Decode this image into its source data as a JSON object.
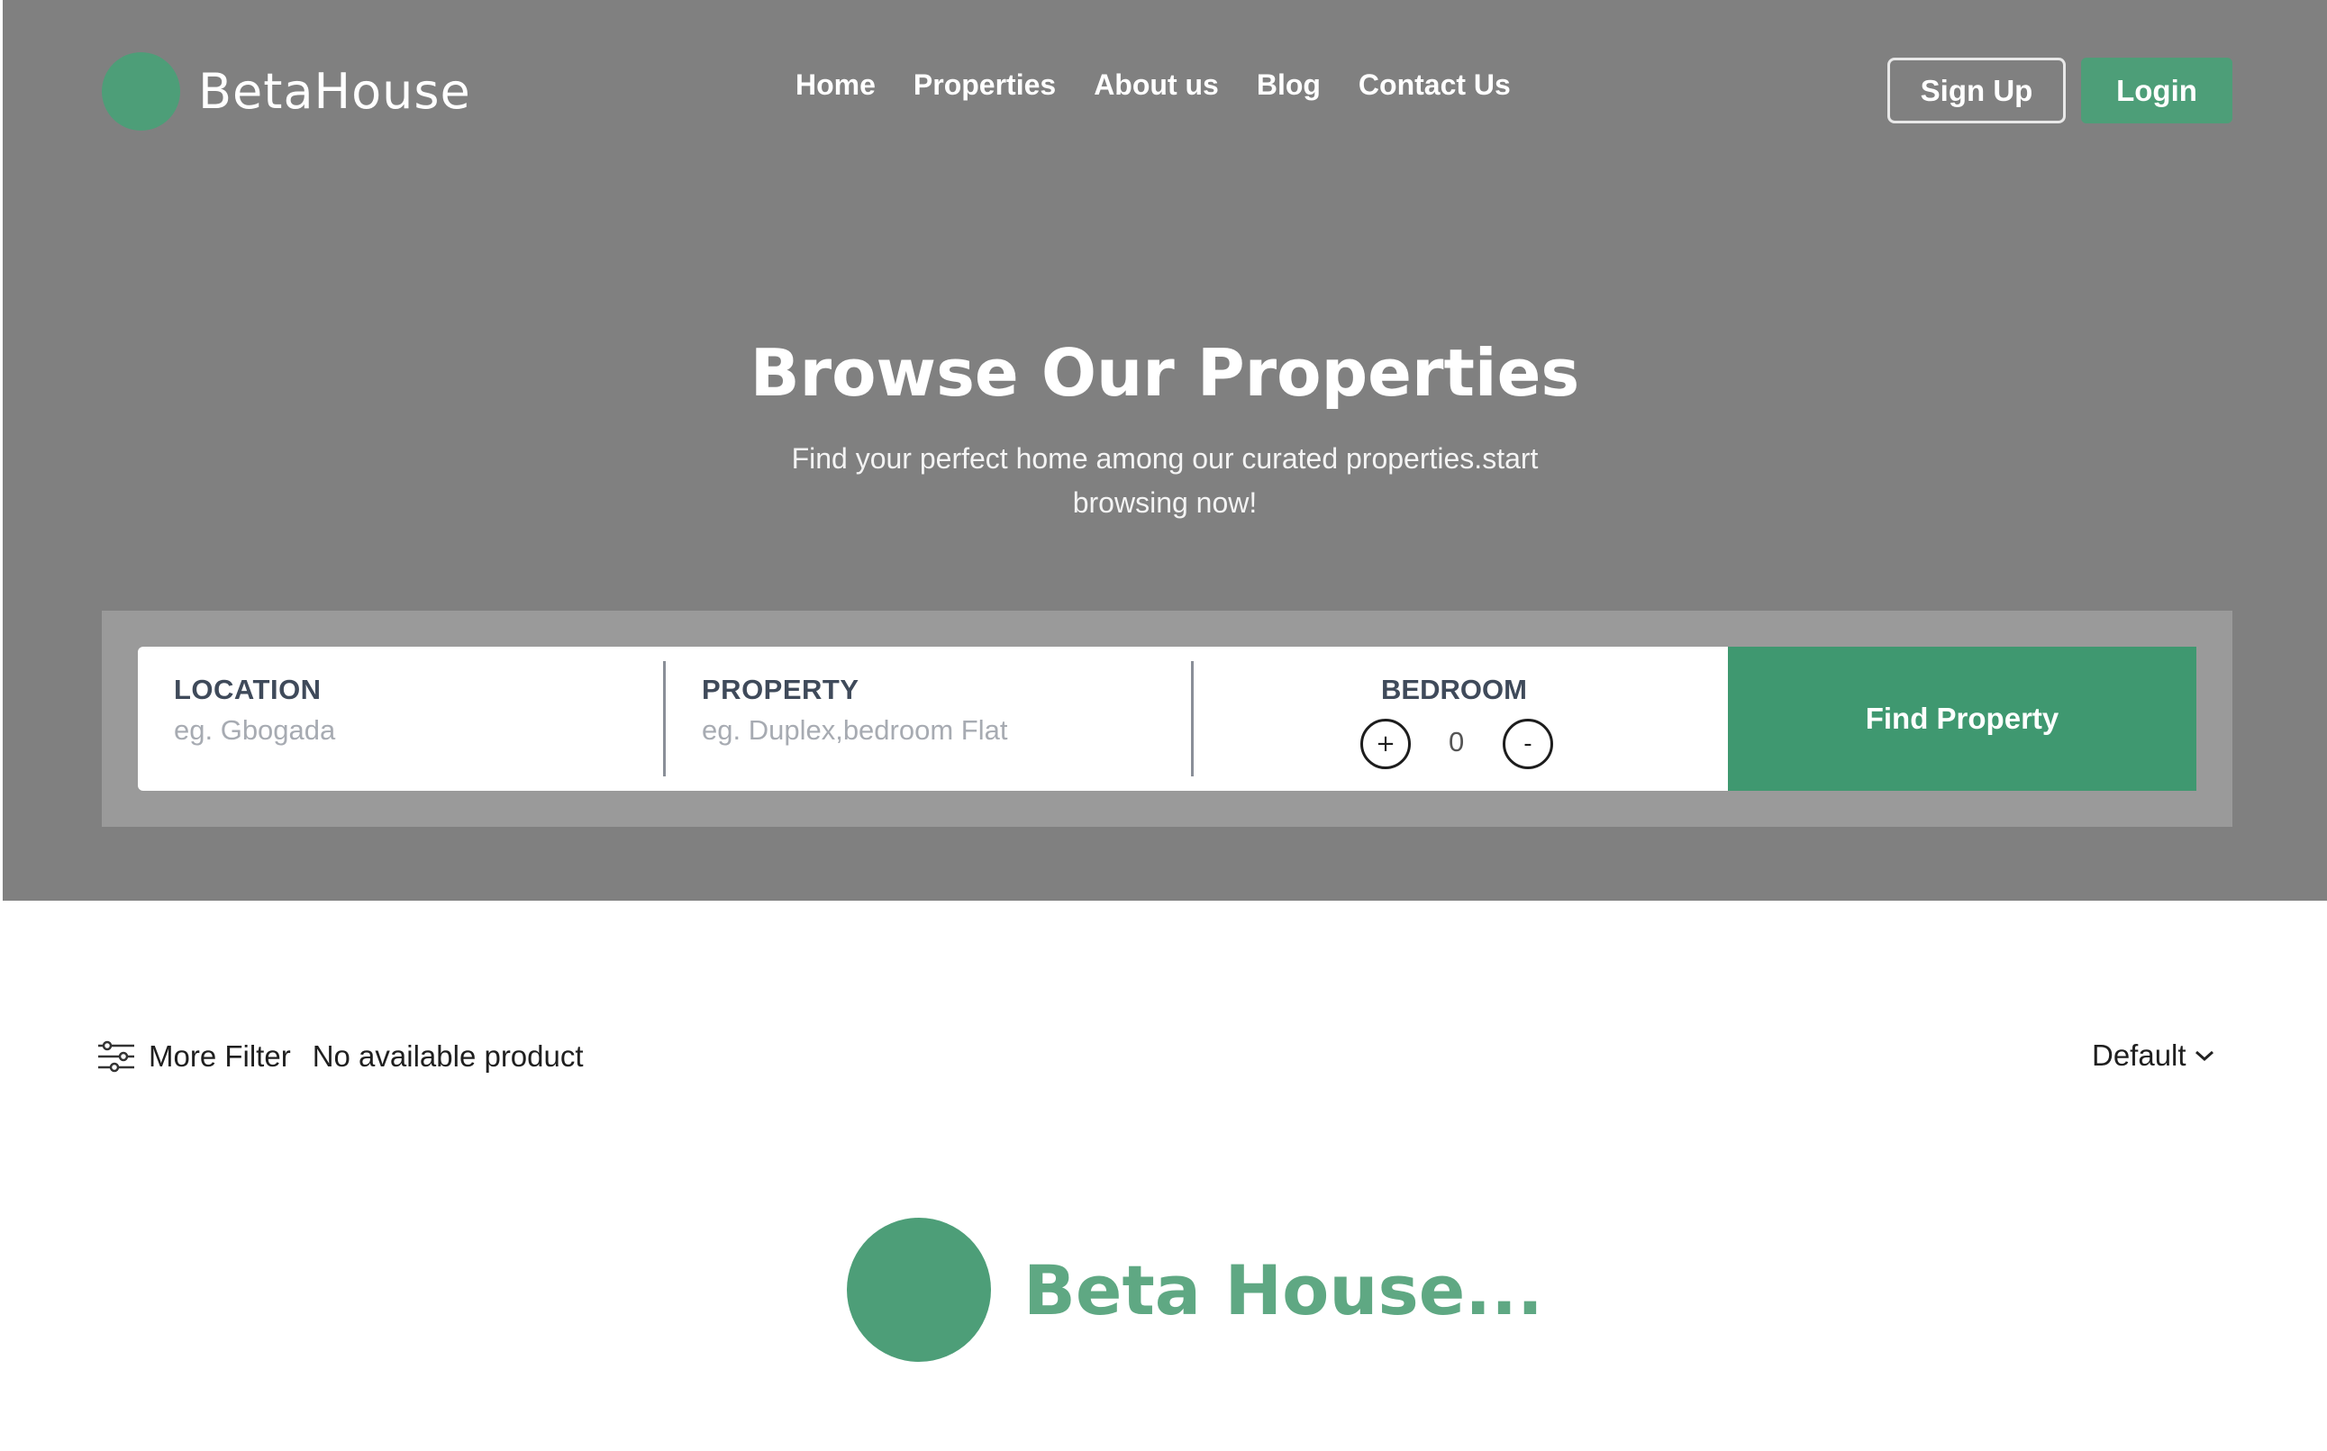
{
  "brand": {
    "name": "BetaHouse",
    "accent_color": "#4d9e78"
  },
  "nav": {
    "items": [
      {
        "label": "Home"
      },
      {
        "label": "Properties"
      },
      {
        "label": "About us"
      },
      {
        "label": "Blog"
      },
      {
        "label": "Contact Us"
      }
    ],
    "signup_label": "Sign Up",
    "login_label": "Login"
  },
  "hero": {
    "title": "Browse Our Properties",
    "subtitle": "Find your perfect home among our curated properties.start browsing now!"
  },
  "search": {
    "location": {
      "label": "LOCATION",
      "placeholder": "eg. Gbogada"
    },
    "property": {
      "label": "PROPERTY",
      "placeholder": "eg. Duplex,bedroom Flat"
    },
    "bedroom": {
      "label": "BEDROOM",
      "count": "0",
      "increment_symbol": "+",
      "decrement_symbol": "-"
    },
    "submit_label": "Find Property"
  },
  "listing": {
    "filter_icon": "sliders-icon",
    "more_filter_label": "More Filter",
    "status_text": "No available product",
    "sort_label": "Default",
    "sort_icon": "chevron-down-icon"
  },
  "loader": {
    "text": "Beta House..."
  }
}
